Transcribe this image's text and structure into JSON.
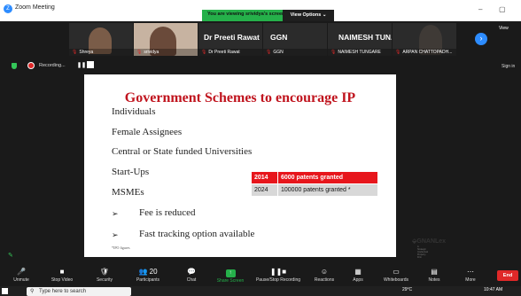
{
  "titlebar": {
    "logo_glyph": "Z",
    "title": "Zoom Meeting",
    "share_banner": "You are viewing srividya's screen",
    "view_options": "View Options  ⌄",
    "minimize": "–",
    "maximize": "▢"
  },
  "participants": [
    {
      "name": "Shreya",
      "kind": "video",
      "bg": "#c9b9a8"
    },
    {
      "name": "srividya",
      "kind": "video",
      "bg": "#8e6b55"
    },
    {
      "name": "Dr Preeti Rawat",
      "kind": "name",
      "bigname": "Dr Preeti Rawat"
    },
    {
      "name": "GGN",
      "kind": "name",
      "bigname": "GGN"
    },
    {
      "name": "NAIMESH TUNGARE",
      "kind": "name",
      "bigname": "NAIMESH TUN..."
    },
    {
      "name": "ARPAN CHATTOPADH...",
      "kind": "video",
      "bg": "#c9c2b2"
    }
  ],
  "strip": {
    "next_glyph": "›",
    "view_label": "View"
  },
  "recording": {
    "label": "Recording...",
    "pause_glyph": "❚❚",
    "sign_in": "Sign in"
  },
  "slide": {
    "title": "Government Schemes to encourage IP",
    "bullets": [
      "Individuals",
      "Female Assignees",
      "Central or State funded Universities",
      "Start-Ups",
      "MSMEs"
    ],
    "arrow_glyph": "➢",
    "sub_bullets": [
      "Fee is reduced",
      "Fast tracking option available"
    ],
    "footnote": "*IPO figures",
    "table": [
      {
        "year": "2014",
        "text": "6000 patents granted"
      },
      {
        "year": "2024",
        "text": "100000 patents granted *"
      }
    ],
    "logo": "⬙GNANLex",
    "logo_sub": "A Strategic Intellectual Property Firm"
  },
  "annotate_glyph": "✎",
  "toolbar": [
    {
      "label": "Unmute",
      "icon": "🎤"
    },
    {
      "label": "Stop Video",
      "icon": "■"
    },
    {
      "label": "Security",
      "icon": "🛡"
    },
    {
      "label": "Participants",
      "icon": "👥 20"
    },
    {
      "label": "Chat",
      "icon": "💬"
    },
    {
      "label": "Share Screen",
      "icon": "↑"
    },
    {
      "label": "Pause/Stop Recording",
      "icon": "❚❚■"
    },
    {
      "label": "Reactions",
      "icon": "☺"
    },
    {
      "label": "Apps",
      "icon": "▦"
    },
    {
      "label": "Whiteboards",
      "icon": "▭"
    },
    {
      "label": "Notes",
      "icon": "▤"
    },
    {
      "label": "More",
      "icon": "⋯"
    }
  ],
  "end_label": "End",
  "taskbar": {
    "search_icon": "⚲",
    "search_placeholder": "Type here to search",
    "temp": "29°C",
    "time": "10:47 AM"
  }
}
